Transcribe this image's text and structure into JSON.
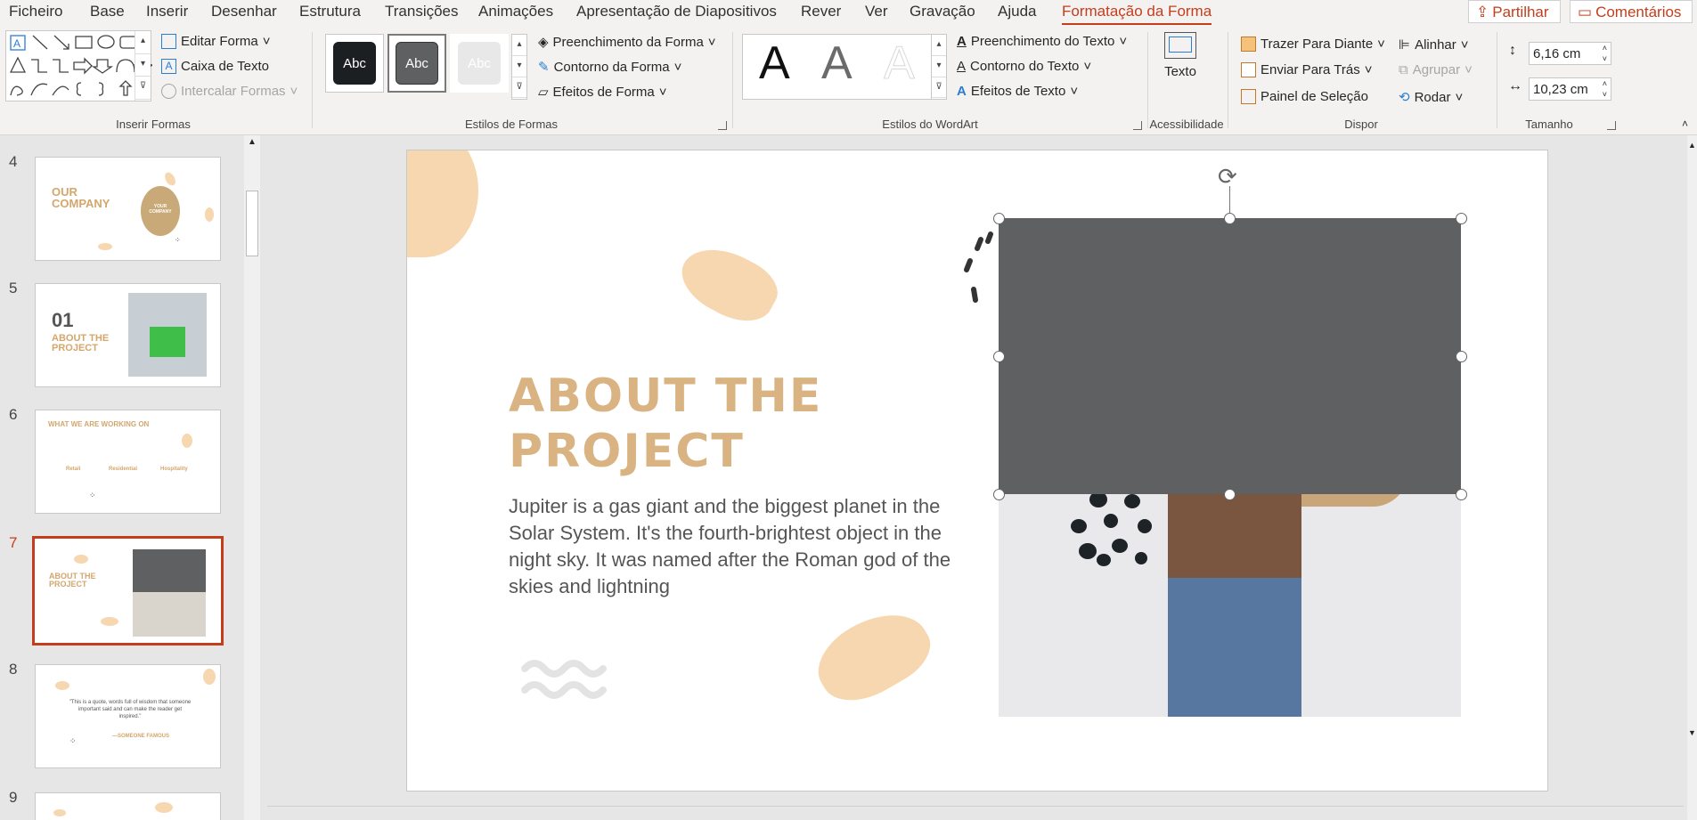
{
  "menu": {
    "tabs": [
      "Ficheiro",
      "Base",
      "Inserir",
      "Desenhar",
      "Estrutura",
      "Transições",
      "Animações",
      "Apresentação de Diapositivos",
      "Rever",
      "Ver",
      "Gravação",
      "Ajuda",
      "Formatação da Forma"
    ],
    "share_label": "Partilhar",
    "comments_label": "Comentários"
  },
  "ribbon": {
    "insert_shapes": {
      "label": "Inserir Formas",
      "edit_shape": "Editar Forma",
      "text_box": "Caixa de Texto",
      "merge_shapes": "Intercalar Formas"
    },
    "shape_styles": {
      "label": "Estilos de Formas",
      "swatch_text": "Abc",
      "fill": "Preenchimento da Forma",
      "outline": "Contorno da Forma",
      "effects": "Efeitos de Forma"
    },
    "wordart": {
      "label": "Estilos do WordArt",
      "glyph": "A",
      "text_fill": "Preenchimento do Texto",
      "text_outline": "Contorno do Texto",
      "text_effects": "Efeitos de Texto"
    },
    "accessibility": {
      "label": "Acessibilidade",
      "alt_text": "Texto"
    },
    "arrange": {
      "label": "Dispor",
      "bring_forward": "Trazer Para Diante",
      "send_backward": "Enviar Para Trás",
      "selection_pane": "Painel de Seleção",
      "align": "Alinhar",
      "group": "Agrupar",
      "rotate": "Rodar"
    },
    "size": {
      "label": "Tamanho",
      "height": "6,16 cm",
      "width": "10,23 cm"
    }
  },
  "thumbnails": [
    {
      "num": "4",
      "title": "OUR COMPANY",
      "badge": "YOUR COMPANY"
    },
    {
      "num": "5",
      "big": "01",
      "title": "ABOUT THE PROJECT"
    },
    {
      "num": "6",
      "title": "WHAT WE ARE WORKING ON",
      "cols": [
        "Retail",
        "Residential",
        "Hospitality"
      ]
    },
    {
      "num": "7",
      "title": "ABOUT THE PROJECT",
      "active": true
    },
    {
      "num": "8",
      "quote": "\"This is a quote, words full of wisdom that someone important said and can make the reader get inspired.\"",
      "author": "—SOMEONE FAMOUS"
    },
    {
      "num": "9"
    }
  ],
  "slide": {
    "title_line1": "ABOUT THE",
    "title_line2": "PROJECT",
    "body": "Jupiter is a gas giant and the biggest planet in the Solar System. It's the fourth-brightest object in the night sky. It was named after the Roman god of the skies and lightning"
  },
  "colors": {
    "accent": "#c43e1c",
    "title": "#d9b382",
    "blob": "#f6d7b0",
    "rect": "#5f6062"
  }
}
